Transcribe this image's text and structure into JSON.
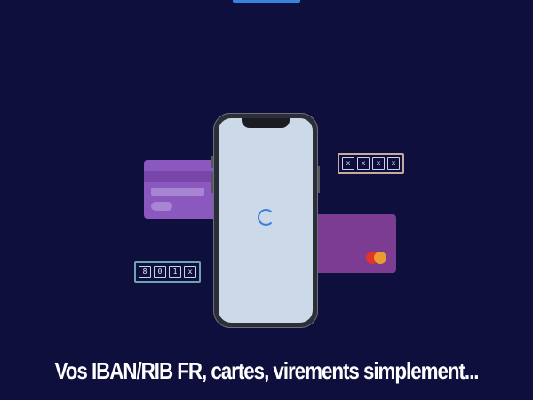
{
  "header": {
    "top_tab_color": "#3b82e0"
  },
  "cards": {
    "left_card_color": "#8b58bf",
    "right_card_color": "#7c3c91",
    "right_card_brand_icon": "mastercard-logo"
  },
  "pins": {
    "right": [
      "x",
      "x",
      "x",
      "x"
    ],
    "left": [
      "8",
      "0",
      "1",
      "x"
    ]
  },
  "phone": {
    "status": "loading-spinner-icon"
  },
  "caption": {
    "text": "Vos IBAN/RIB FR, cartes, virements simplement..."
  },
  "colors": {
    "background": "#0e0f3d",
    "spinner": "#3f7ed8",
    "screen": "#cbd9e8"
  }
}
